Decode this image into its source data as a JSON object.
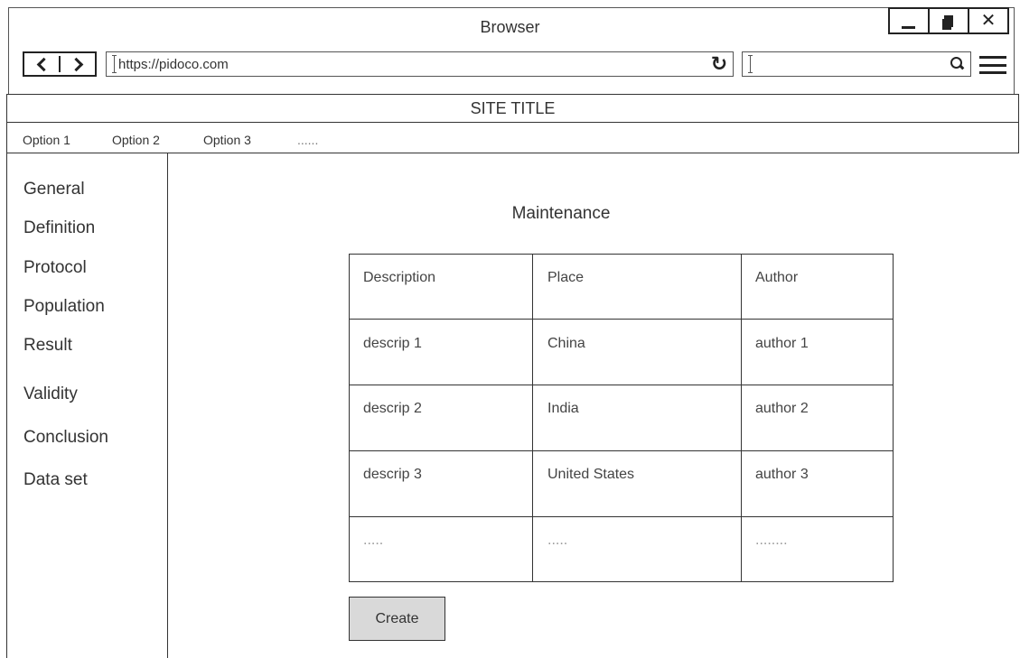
{
  "browser": {
    "title": "Browser",
    "url": "https://pidoco.com",
    "search_value": ""
  },
  "site": {
    "title": "SITE TITLE",
    "options": [
      "Option 1",
      "Option 2",
      "Option 3",
      "......"
    ]
  },
  "sidebar": {
    "items": [
      "General",
      "Definition",
      "Protocol",
      "Population",
      "Result",
      "Validity",
      "Conclusion",
      "Data set"
    ]
  },
  "main": {
    "title": "Maintenance",
    "table": {
      "headers": [
        "Description",
        "Place",
        "Author"
      ],
      "rows": [
        [
          "descrip 1",
          "China",
          "author 1"
        ],
        [
          "descrip 2",
          "India",
          "author 2"
        ],
        [
          "descrip 3",
          "United States",
          "author 3"
        ],
        [
          ".....",
          ".....",
          "........"
        ]
      ]
    },
    "create_label": "Create"
  },
  "icons": {
    "minimize": "minimize-icon",
    "maximize": "maximize-icon",
    "close": "close-icon",
    "back": "chevron-left-icon",
    "forward": "chevron-right-icon",
    "reload": "reload-icon",
    "search": "search-icon",
    "menu": "hamburger-menu-icon"
  }
}
